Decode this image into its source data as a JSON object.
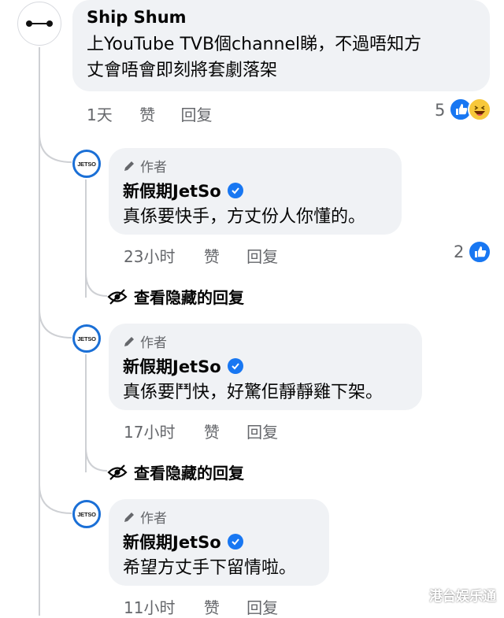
{
  "top_comment": {
    "author": "Ship Shum",
    "text_line1": "上YouTube TVB個channel睇，不過唔知方",
    "text_line2": "丈會唔會即刻將套劇落架",
    "time": "1天",
    "like_label": "赞",
    "reply_label": "回复",
    "reaction_count": "5"
  },
  "replies": [
    {
      "author_badge": "作者",
      "author": "新假期JetSo",
      "avatar_text": "JETSO",
      "text": "真係要快手，方丈份人你懂的。",
      "time": "23小时",
      "like_label": "赞",
      "reply_label": "回复",
      "reaction_count": "2"
    },
    {
      "author_badge": "作者",
      "author": "新假期JetSo",
      "avatar_text": "JETSO",
      "text": "真係要鬥快，好驚佢靜靜雞下架。",
      "time": "17小时",
      "like_label": "赞",
      "reply_label": "回复"
    },
    {
      "author_badge": "作者",
      "author": "新假期JetSo",
      "avatar_text": "JETSO",
      "text": "希望方丈手下留情啦。",
      "time": "11小时",
      "like_label": "赞",
      "reply_label": "回复"
    }
  ],
  "hidden_replies_label": "查看隐藏的回复",
  "watermark": "港台娱乐通",
  "colors": {
    "bubble": "#f0f2f5",
    "meta": "#65676b",
    "like_blue": "#1877f2",
    "avatar_ring": "#1a6fd6"
  },
  "icons": [
    "like-icon",
    "haha-icon",
    "pencil-icon",
    "verified-icon",
    "eye-slash-icon"
  ]
}
